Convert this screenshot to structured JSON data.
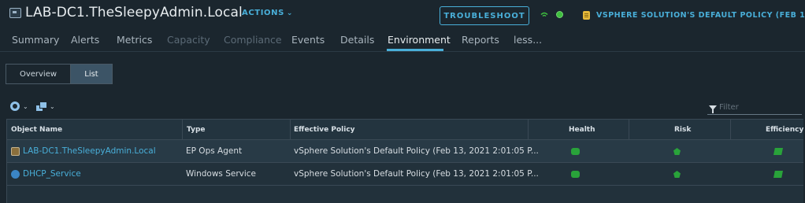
{
  "header": {
    "title": "LAB-DC1.TheSleepyAdmin.Local",
    "actions_label": "ACTIONS",
    "troubleshoot_label": "TROUBLESHOOT",
    "policy_label": "VSPHERE SOLUTION'S DEFAULT POLICY (FEB 1...",
    "status_color": "#3fbf3f"
  },
  "tabs": [
    {
      "label": "Summary",
      "state": "normal"
    },
    {
      "label": "Alerts",
      "state": "normal"
    },
    {
      "label": "Metrics",
      "state": "normal"
    },
    {
      "label": "Capacity",
      "state": "disabled"
    },
    {
      "label": "Compliance",
      "state": "disabled"
    },
    {
      "label": "Events",
      "state": "normal"
    },
    {
      "label": "Details",
      "state": "normal"
    },
    {
      "label": "Environment",
      "state": "active"
    },
    {
      "label": "Reports",
      "state": "normal"
    },
    {
      "label": "less...",
      "state": "normal"
    }
  ],
  "view_toggle": {
    "overview_label": "Overview",
    "list_label": "List",
    "selected": "List"
  },
  "toolbar": {
    "icons": [
      "gear-icon",
      "stack-icon"
    ]
  },
  "filter": {
    "placeholder": "Filter"
  },
  "table": {
    "columns": [
      "Object Name",
      "Type",
      "Effective Policy",
      "Health",
      "Risk",
      "Efficiency"
    ],
    "rows": [
      {
        "object_name": "LAB-DC1.TheSleepyAdmin.Local",
        "object_icon": "ep-ops-agent-icon",
        "type": "EP Ops Agent",
        "policy": "vSphere Solution's Default Policy (Feb 13, 2021 2:01:05 P...",
        "health": "good",
        "risk": "good",
        "efficiency": "good"
      },
      {
        "object_name": "DHCP_Service",
        "object_icon": "windows-service-icon",
        "type": "Windows Service",
        "policy": "vSphere Solution's Default Policy (Feb 13, 2021 2:01:05 P...",
        "health": "good",
        "risk": "good",
        "efficiency": "good"
      }
    ]
  },
  "colors": {
    "accent": "#49afd9",
    "background": "#1b262e",
    "status_good": "#29a33a"
  }
}
